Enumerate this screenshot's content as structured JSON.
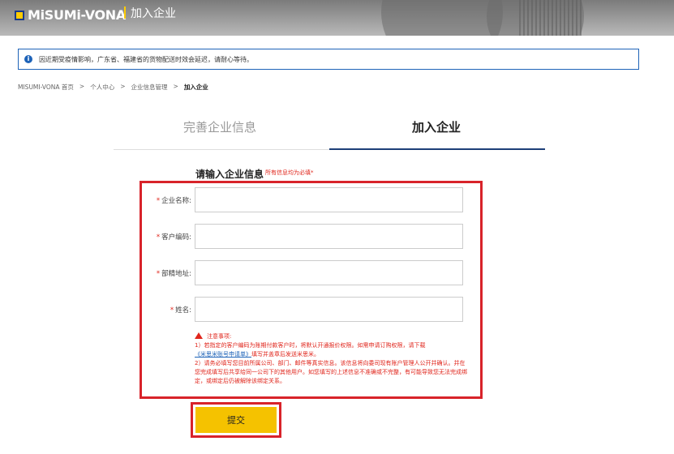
{
  "header": {
    "logo_text": "MiSUMi-VONA",
    "title": "加入企业"
  },
  "notice": {
    "icon": "info-icon",
    "text": "因近期受疫情影响，广东省、福建省的货物配送时效会延迟，请耐心等待。"
  },
  "breadcrumb": {
    "items": [
      "MISUMI-VONA 首页",
      "个人中心",
      "企业信息管理",
      "加入企业"
    ],
    "separator": ">"
  },
  "tabs": [
    {
      "label": "完善企业信息"
    },
    {
      "label": "加入企业"
    }
  ],
  "form": {
    "title": "请输入企业信息",
    "required_note": "所有信息均为必填*",
    "fields": [
      {
        "label": "企业名称:",
        "value": "",
        "placeholder": ""
      },
      {
        "label": "客户编码:",
        "value": "",
        "placeholder": ""
      },
      {
        "label": "部精地址:",
        "value": "",
        "placeholder": ""
      },
      {
        "label": "姓名:",
        "value": "",
        "placeholder": ""
      }
    ],
    "required_mark": "*",
    "notes": {
      "heading": "注意事项:",
      "line1": "1）若指定的客户编码为账期付款客户时，将默认开通报价权限。如需申请订购权限，请下载",
      "link": "《米思米账号申请单》",
      "line1b": "填写并盖章后发送米思米。",
      "line2": "2）请务必填写您目前所属公司、部门、邮件等真实信息。该信息将向委司现有账户管理人公开并确认。并在您完成填写后共享给同一公司下的其他用户。如您填写的上述信息不准确或不完整，有可能导致您无法完成绑定，或绑定后仍被解除该绑定关系。"
    },
    "submit_label": "提交"
  },
  "colors": {
    "accent_red": "#d8232a",
    "brand_yellow": "#f5c200",
    "link_blue": "#1e63b8",
    "tab_underline": "#1e3f78"
  }
}
